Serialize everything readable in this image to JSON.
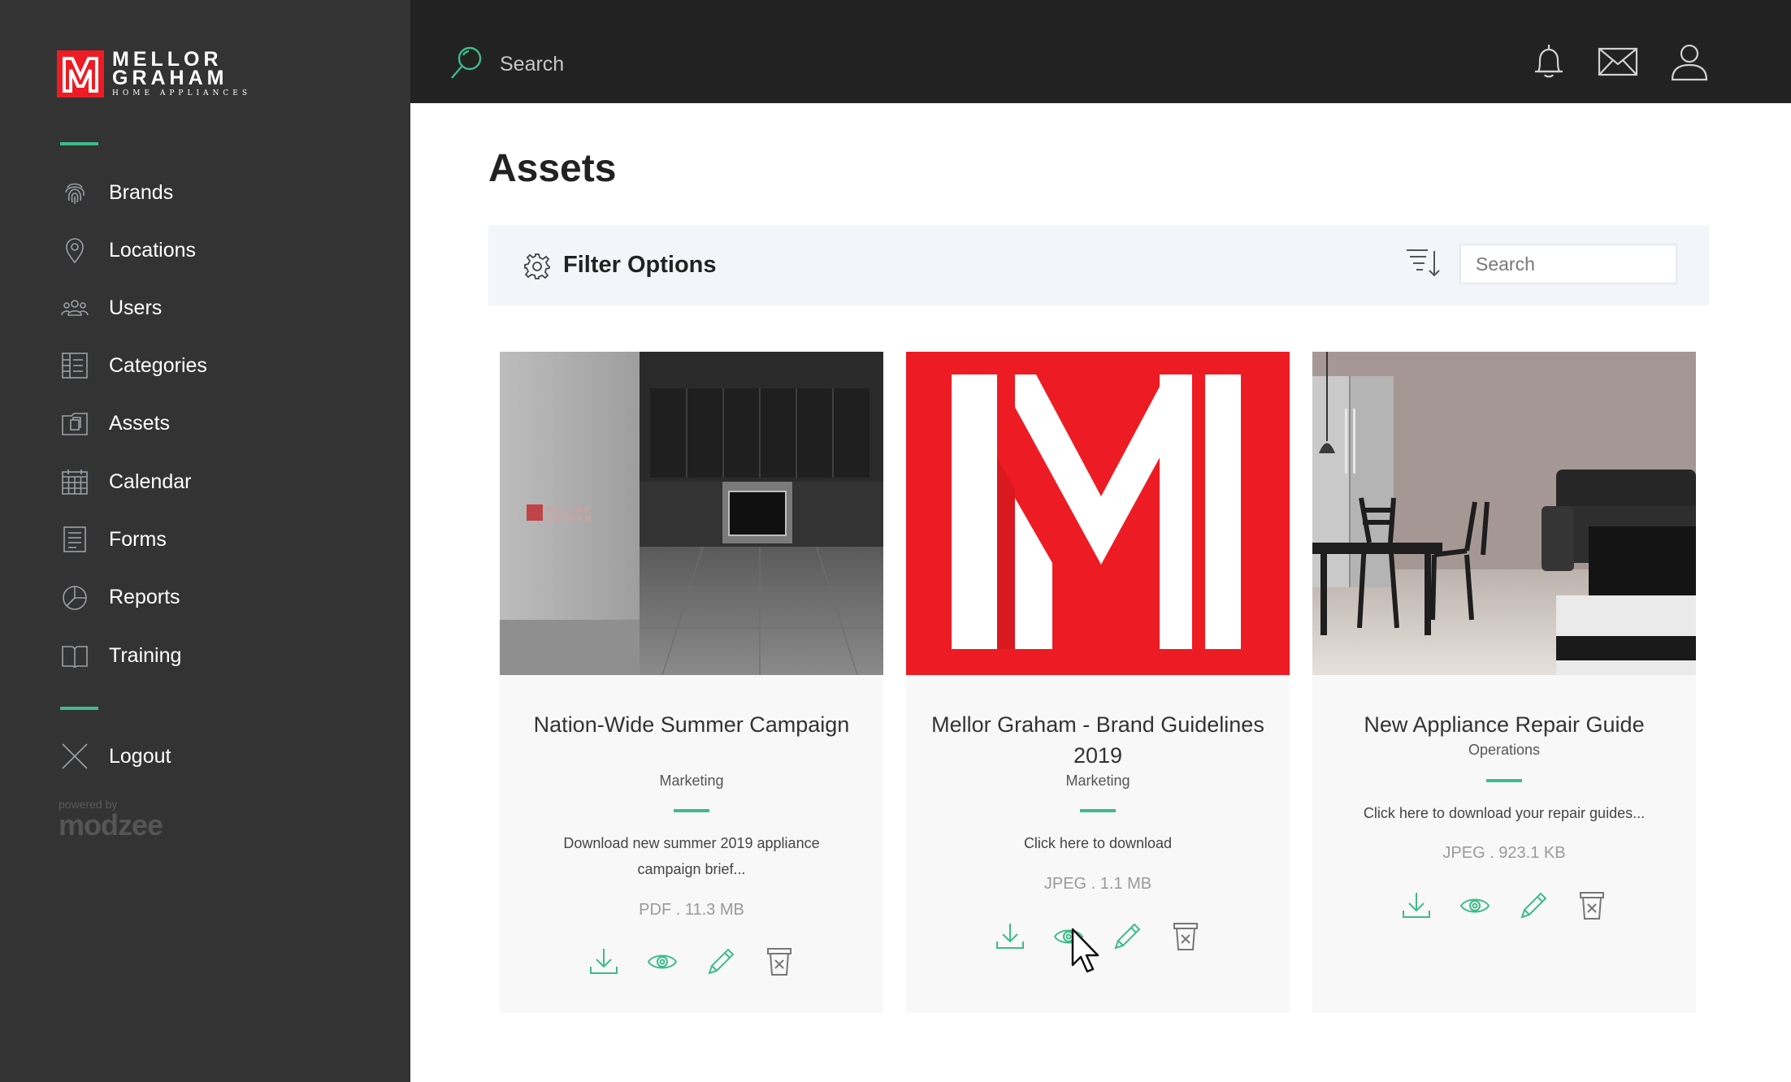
{
  "brand": {
    "line1": "MELLOR",
    "line2": "GRAHAM",
    "line3": "HOME APPLIANCES",
    "mark": "M",
    "accent_color": "#ed1c24"
  },
  "sidebar": {
    "items": [
      {
        "label": "Brands",
        "icon": "fingerprint-icon"
      },
      {
        "label": "Locations",
        "icon": "location-pin-icon"
      },
      {
        "label": "Users",
        "icon": "users-icon"
      },
      {
        "label": "Categories",
        "icon": "categories-icon"
      },
      {
        "label": "Assets",
        "icon": "assets-icon"
      },
      {
        "label": "Calendar",
        "icon": "calendar-icon"
      },
      {
        "label": "Forms",
        "icon": "forms-icon"
      },
      {
        "label": "Reports",
        "icon": "pie-chart-icon"
      },
      {
        "label": "Training",
        "icon": "book-icon"
      }
    ],
    "logout": {
      "label": "Logout",
      "icon": "close-icon"
    },
    "powered_by": "powered by",
    "powered_brand": "modzee",
    "divider_color": "#3dbb8c"
  },
  "topbar": {
    "search_placeholder": "Search",
    "icons": [
      "bell-icon",
      "mail-icon",
      "user-icon"
    ]
  },
  "main": {
    "title": "Assets",
    "filter": {
      "label": "Filter Options",
      "search_placeholder": "Search"
    },
    "cards": [
      {
        "title": "Nation-Wide Summer Campaign",
        "category": "Marketing",
        "description": "Download new summer 2019 appliance campaign brief...",
        "meta": "PDF . 11.3 MB",
        "image": "kitchen-photo"
      },
      {
        "title": "Mellor Graham - Brand Guidelines 2019",
        "category": "Marketing",
        "description": "Click here to download",
        "meta": "JPEG . 1.1 MB",
        "image": "brand-logo"
      },
      {
        "title": "New Appliance Repair Guide",
        "category": "Operations",
        "description": "Click here to download your repair guides...",
        "meta": "JPEG . 923.1 KB",
        "image": "dining-room-photo"
      }
    ],
    "card_actions": [
      "download-icon",
      "view-icon",
      "edit-icon",
      "delete-icon"
    ]
  }
}
